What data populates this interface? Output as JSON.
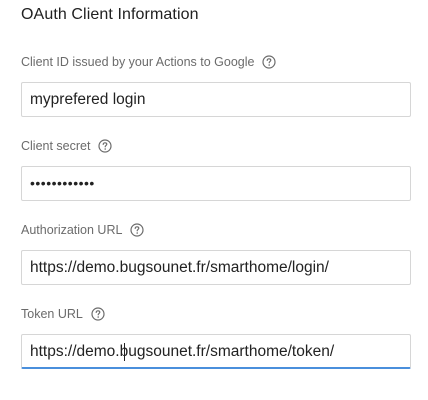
{
  "section": {
    "title": "OAuth Client Information"
  },
  "fields": {
    "client_id": {
      "label": "Client ID issued by your Actions to Google",
      "value": "myprefered login"
    },
    "client_secret": {
      "label": "Client secret",
      "value": "••••••••••••"
    },
    "authorization_url": {
      "label": "Authorization URL",
      "value": "https://demo.bugsounet.fr/smarthome/login/"
    },
    "token_url": {
      "label": "Token URL",
      "value": "https://demo.bugsounet.fr/smarthome/token/"
    }
  },
  "icons": {
    "help": "help-circle-icon"
  },
  "colors": {
    "focus_underline": "#4a8fdc",
    "label_text": "#6b6b6b",
    "border": "#d6d6d6"
  }
}
